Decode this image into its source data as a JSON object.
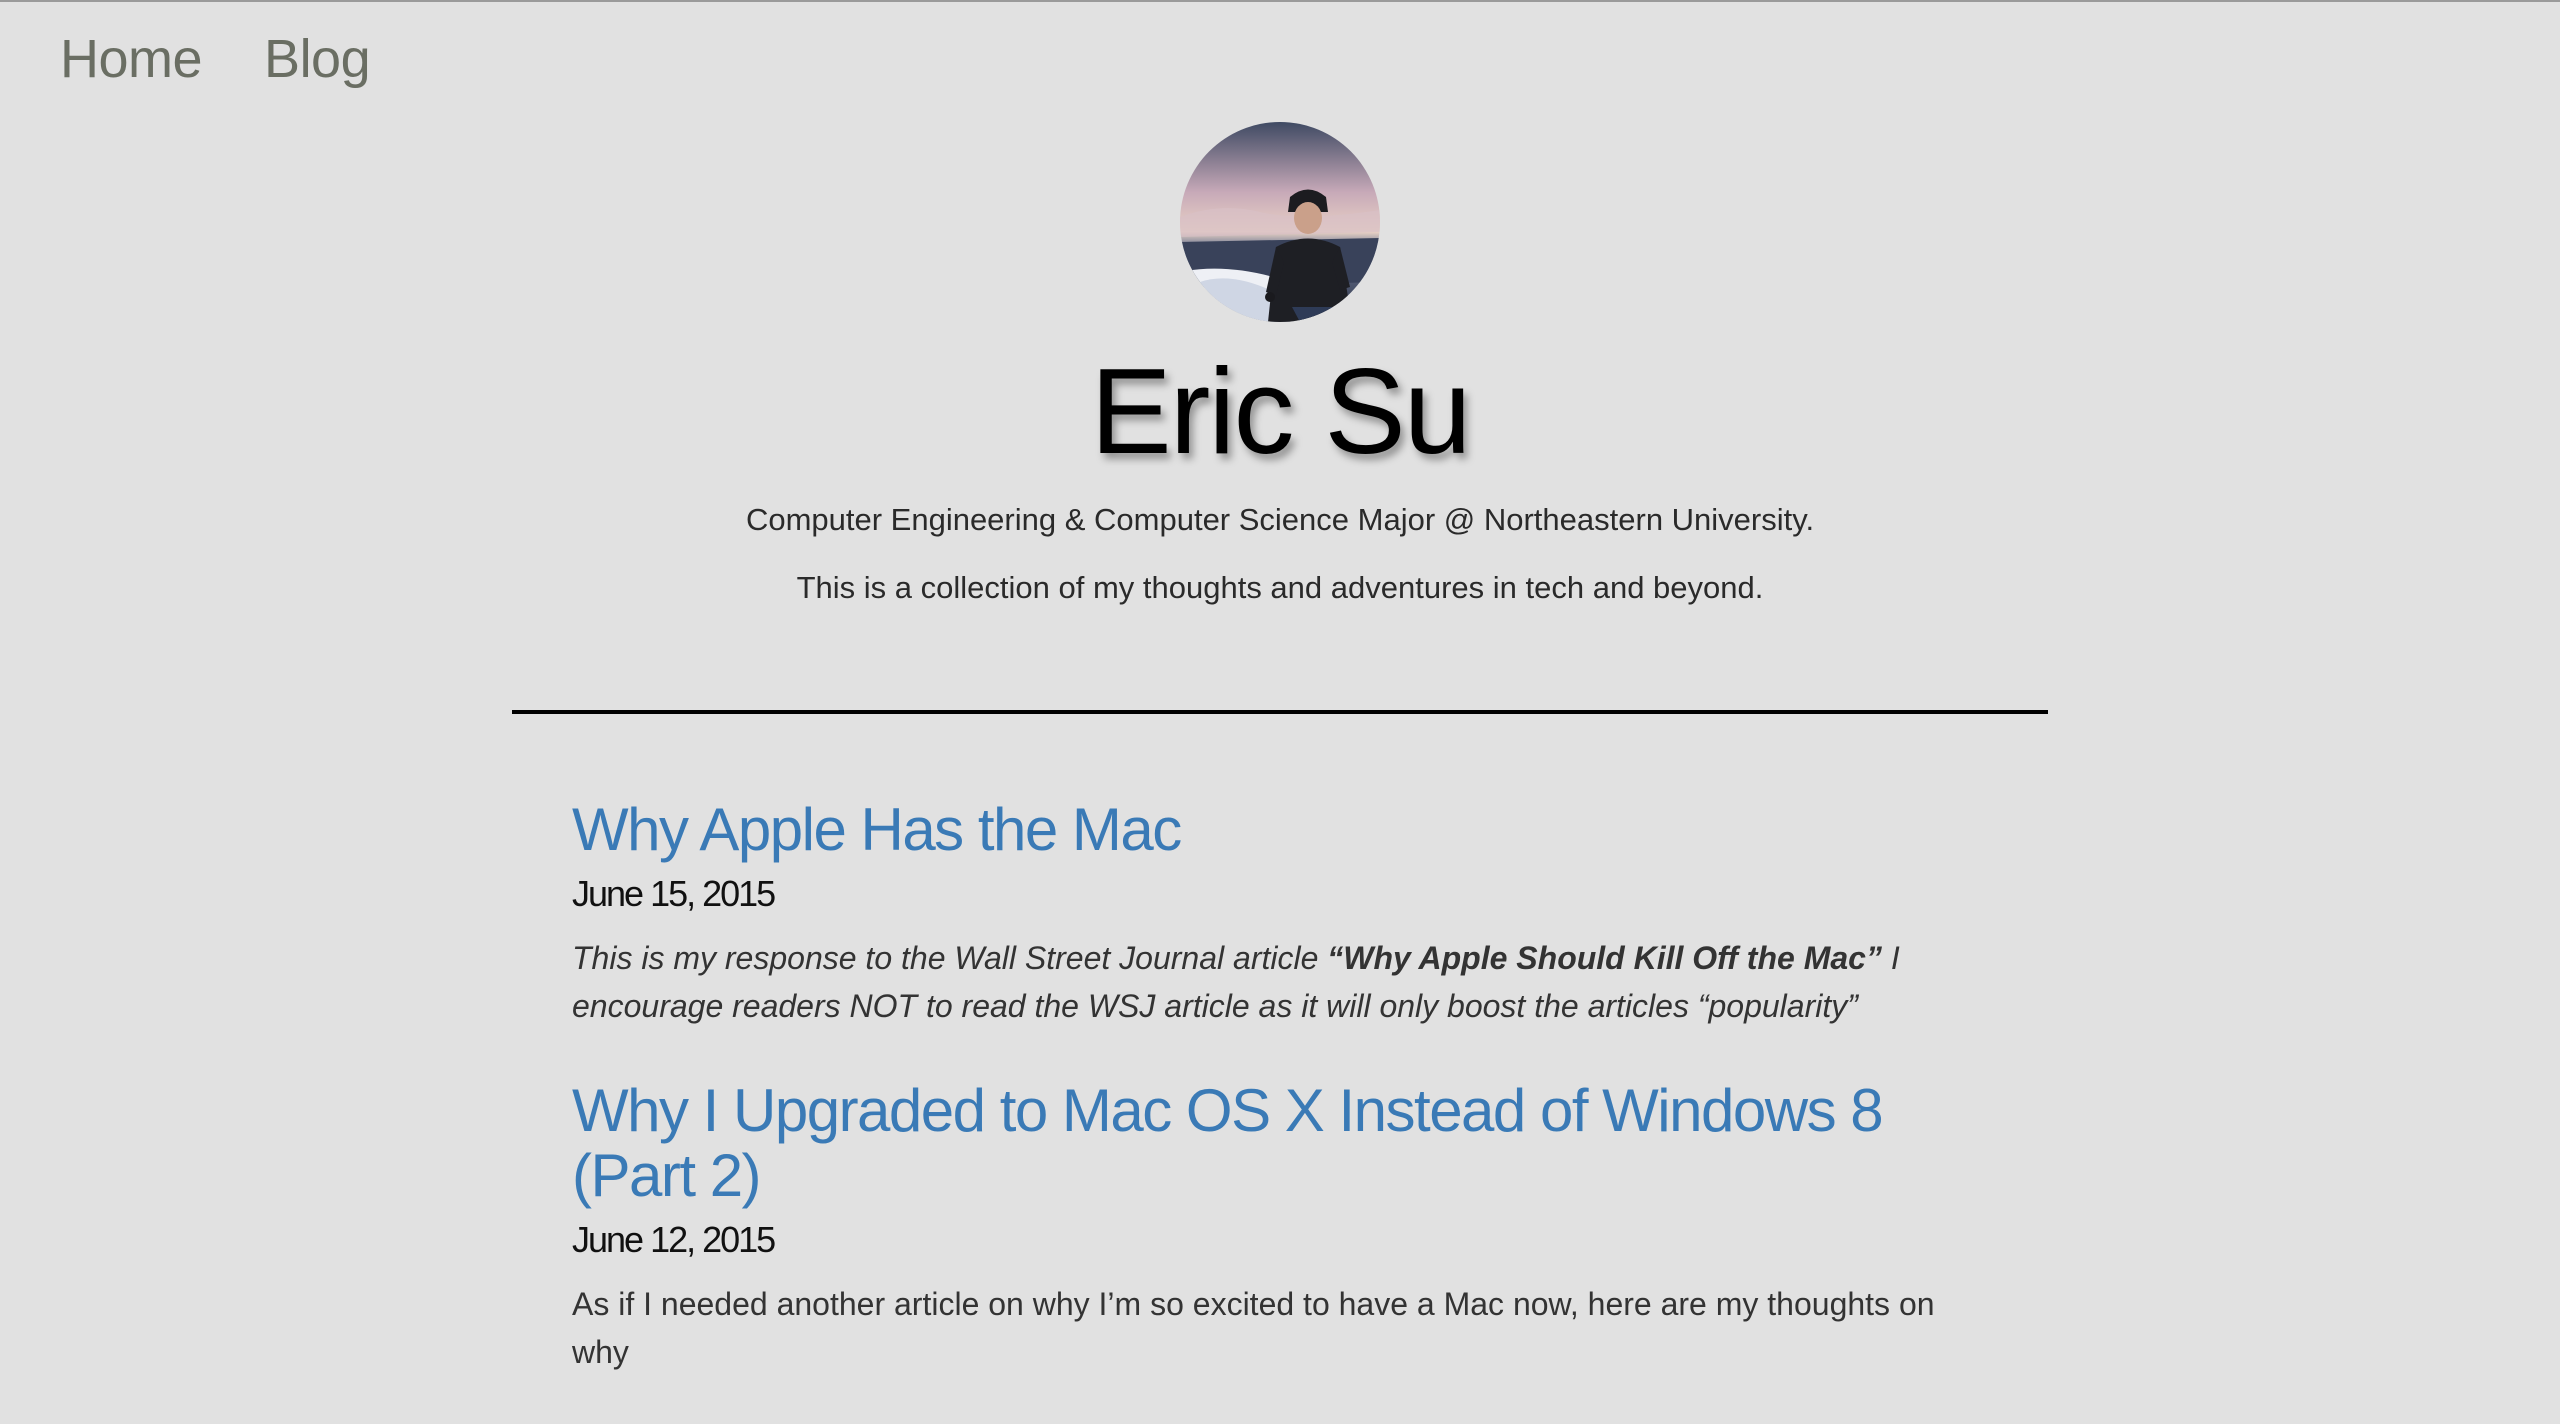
{
  "nav": {
    "home_label": "Home",
    "blog_label": "Blog"
  },
  "header": {
    "name": "Eric Su",
    "tagline_1": "Computer Engineering & Computer Science Major @ Northeastern University.",
    "tagline_2": "This is a collection of my thoughts and adventures in tech and beyond."
  },
  "posts": [
    {
      "title": "Why Apple Has the Mac",
      "date": "June 15, 2015",
      "excerpt_before": "This is my response to the Wall Street Journal article ",
      "excerpt_bold": "“Why Apple Should Kill Off the Mac”",
      "excerpt_after": " I encourage readers NOT to read the WSJ article as it will only boost the articles “popularity”"
    },
    {
      "title": "Why I Upgraded to Mac OS X Instead of Windows 8 (Part 2)",
      "date": "June 12, 2015",
      "excerpt": "As if I needed another article on why I’m so excited to have a Mac now, here are my thoughts on why"
    }
  ],
  "colors": {
    "background": "#e1e1e1",
    "link": "#3a7ab6",
    "nav": "#6a6e63"
  }
}
